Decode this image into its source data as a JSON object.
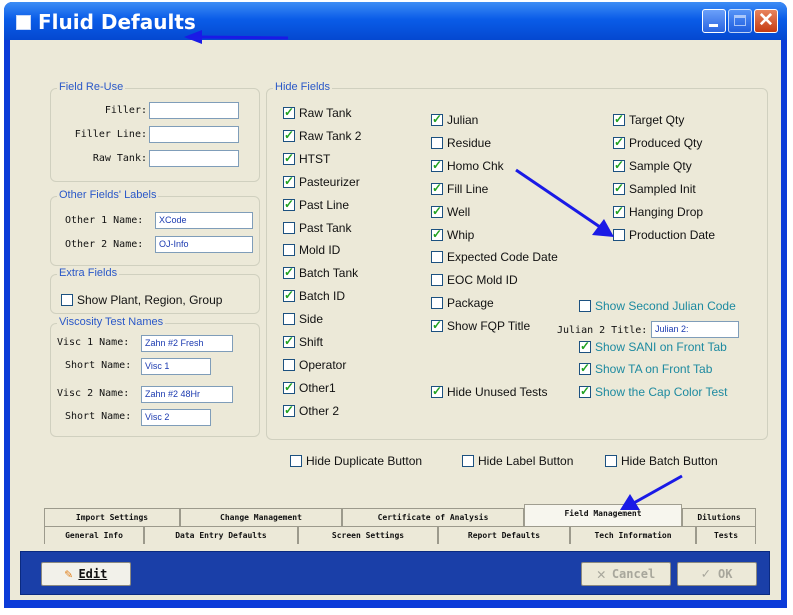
{
  "window": {
    "title": "Fluid Defaults",
    "close_glyph": "✕"
  },
  "field_reuse": {
    "title": "Field Re-Use",
    "filler_label": "Filler:",
    "filler_line_label": "Filler Line:",
    "raw_tank_label": "Raw Tank:"
  },
  "other_labels": {
    "title": "Other Fields' Labels",
    "other1_label": "Other 1 Name:",
    "other1_value": "XCode",
    "other2_label": "Other 2 Name:",
    "other2_value": "OJ-Info"
  },
  "extra_fields": {
    "title": "Extra Fields",
    "show_plant_label": "Show Plant, Region, Group"
  },
  "viscosity": {
    "title": "Viscosity Test Names",
    "visc1_label": "Visc 1 Name:",
    "visc1_value": "Zahn #2 Fresh",
    "short1_label": "Short Name:",
    "short1_value": "Visc 1",
    "visc2_label": "Visc 2 Name:",
    "visc2_value": "Zahn #2 48Hr",
    "short2_label": "Short Name:",
    "short2_value": "Visc 2"
  },
  "hide_fields": {
    "title": "Hide Fields",
    "col1": [
      {
        "label": "Raw Tank",
        "checked": true
      },
      {
        "label": "Raw Tank 2",
        "checked": true
      },
      {
        "label": "HTST",
        "checked": true
      },
      {
        "label": "Pasteurizer",
        "checked": true
      },
      {
        "label": "Past Line",
        "checked": true
      },
      {
        "label": "Past Tank",
        "checked": false
      },
      {
        "label": "Mold ID",
        "checked": false
      },
      {
        "label": "Batch Tank",
        "checked": true
      },
      {
        "label": "Batch ID",
        "checked": true
      },
      {
        "label": "Side",
        "checked": false
      },
      {
        "label": "Shift",
        "checked": true
      },
      {
        "label": "Operator",
        "checked": false
      },
      {
        "label": "Other1",
        "checked": true
      },
      {
        "label": "Other 2",
        "checked": true
      }
    ],
    "col2": [
      {
        "label": "Julian",
        "checked": true
      },
      {
        "label": "Residue",
        "checked": false
      },
      {
        "label": "Homo Chk",
        "checked": true
      },
      {
        "label": "Fill Line",
        "checked": true
      },
      {
        "label": "Well",
        "checked": true
      },
      {
        "label": "Whip",
        "checked": true
      },
      {
        "label": "Expected Code Date",
        "checked": false
      },
      {
        "label": "EOC Mold ID",
        "checked": false
      },
      {
        "label": "Package",
        "checked": false
      },
      {
        "label": "Show FQP Title",
        "checked": true
      }
    ],
    "hide_unused_tests": {
      "label": "Hide Unused Tests",
      "checked": true
    },
    "col3": [
      {
        "label": "Target Qty",
        "checked": true
      },
      {
        "label": "Produced Qty",
        "checked": true
      },
      {
        "label": "Sample Qty",
        "checked": true
      },
      {
        "label": "Sampled Init",
        "checked": true
      },
      {
        "label": "Hanging Drop",
        "checked": true
      },
      {
        "label": "Production Date",
        "checked": false
      }
    ],
    "show_second_julian": {
      "label": "Show Second Julian Code",
      "checked": false
    },
    "julian2_label": "Julian 2 Title:",
    "julian2_value": "Julian 2:",
    "show_sani": {
      "label": "Show SANI on Front Tab",
      "checked": true
    },
    "show_ta": {
      "label": "Show TA on Front Tab",
      "checked": true
    },
    "show_cap": {
      "label": "Show the Cap Color Test",
      "checked": true
    }
  },
  "hide_buttons": {
    "duplicate": {
      "label": "Hide Duplicate Button",
      "checked": false
    },
    "label": {
      "label": "Hide Label Button",
      "checked": false
    },
    "batch": {
      "label": "Hide Batch Button",
      "checked": false
    }
  },
  "tabs_row1": [
    "Import Settings",
    "Change Management",
    "Certificate of Analysis",
    "Field Management",
    "Dilutions"
  ],
  "tabs_row2": [
    "General Info",
    "Data Entry Defaults",
    "Screen Settings",
    "Report Defaults",
    "Tech Information",
    "Tests"
  ],
  "active_tab": "Field Management",
  "footer": {
    "edit_label": "Edit",
    "cancel_label": "Cancel",
    "ok_label": "OK",
    "edit_icon": "pencil-icon",
    "cancel_icon": "x-icon",
    "ok_icon": "check-icon"
  },
  "colors": {
    "title_blue": "#0a5ce8",
    "annotation_arrow": "#1a1ae6",
    "footer_blue": "#1a3fa8",
    "checkmark_green": "#21a121",
    "teal_text": "#1d8aa0"
  }
}
